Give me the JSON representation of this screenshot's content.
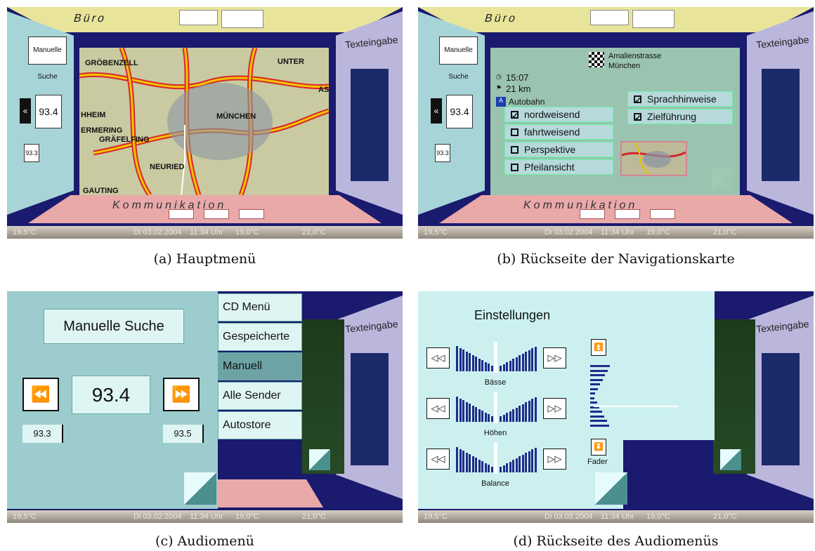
{
  "common": {
    "ceiling_label": "Büro",
    "floor_label": "Kommunikation",
    "right_wall_title": "Texteingabe",
    "status": {
      "temp_left": "19,5°C",
      "date": "Di 03.02.2004",
      "time": "11:34 Uhr",
      "temp_mid": "19,0°C",
      "temp_right": "21,0°C"
    },
    "left_wall": {
      "search_label": "Manuelle Suche",
      "freq": "93.4",
      "freq_prev": "93.3",
      "prev_icon": "rewind-icon",
      "next_icon": "fast-forward-icon"
    }
  },
  "captions": {
    "a": "(a) Hauptmenü",
    "b": "(b) Rückseite der Navigationskarte",
    "c": "(c) Audiomenü",
    "d": "(d) Rückseite des Audiomenüs"
  },
  "map": {
    "labels": [
      "GRÖBENZELL",
      "UNTER",
      "AS",
      "HHEIM",
      "MÜNCHEN",
      "ERMERING",
      "GRÄFELFING",
      "NEURIED",
      "GAUTING"
    ]
  },
  "nav": {
    "destination_street": "Amalienstrasse",
    "destination_city": "München",
    "arrival_time": "15:07",
    "distance": "21 km",
    "road_type": "Autobahn",
    "view_options": [
      {
        "label": "nordweisend",
        "checked": true
      },
      {
        "label": "fahrtweisend",
        "checked": false
      },
      {
        "label": "Perspektive",
        "checked": false
      },
      {
        "label": "Pfeilansicht",
        "checked": false
      }
    ],
    "guidance_options": [
      {
        "label": "Sprachhinweise",
        "checked": true
      },
      {
        "label": "Zielführung",
        "checked": true
      }
    ]
  },
  "audio": {
    "title": "Manuelle Suche",
    "prev_icon": "rewind-icon",
    "next_icon": "fast-forward-icon",
    "prev_glyph": "⏪",
    "next_glyph": "⏩",
    "frequency": "93.4",
    "freq_prev": "93.3",
    "freq_next": "93.5",
    "menu_items": [
      {
        "label": "CD Menü",
        "active": false
      },
      {
        "label": "Gespeicherte",
        "active": false
      },
      {
        "label": "Manuell",
        "active": true
      },
      {
        "label": "Alle Sender",
        "active": false
      },
      {
        "label": "Autostore",
        "active": false
      }
    ]
  },
  "settings": {
    "title": "Einstellungen",
    "controls": [
      {
        "label": "Bässe",
        "level": 0.5
      },
      {
        "label": "Höhen",
        "level": 0.5
      },
      {
        "label": "Balance",
        "level": 0.5
      }
    ],
    "fader_label": "Fader",
    "fader_up_glyph": "⏫",
    "fader_down_glyph": "⏬"
  },
  "colors": {
    "frame": "#1a1a6e",
    "left_wall": "#a7d5d7",
    "right_wall": "#bbb6dc",
    "ceiling": "#e8e49a",
    "floor": "#e9a9a9",
    "active_menu": "#6ea3a5",
    "road": "#f5c400",
    "road_red": "#d8262a"
  }
}
